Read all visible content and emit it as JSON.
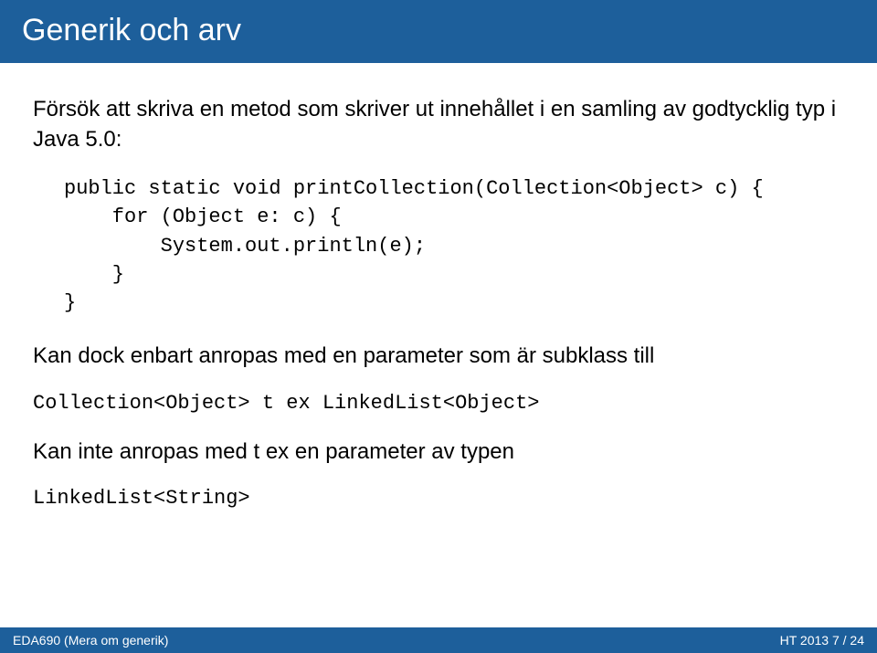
{
  "title": "Generik och arv",
  "intro": "Försök att skriva en metod som skriver ut innehållet i en samling av godtycklig typ i Java 5.0:",
  "code": "public static void printCollection(Collection<Object> c) {\n    for (Object e: c) {\n        System.out.println(e);\n    }\n}",
  "para1": "Kan dock enbart anropas med en parameter som är subklass till",
  "code_inline1": "Collection<Object> t ex LinkedList<Object>",
  "para2": "Kan inte anropas med t ex en parameter av typen",
  "code_inline2": "LinkedList<String>",
  "footer": {
    "left": "EDA690 (Mera om generik)",
    "right": "HT 2013    7 / 24"
  }
}
